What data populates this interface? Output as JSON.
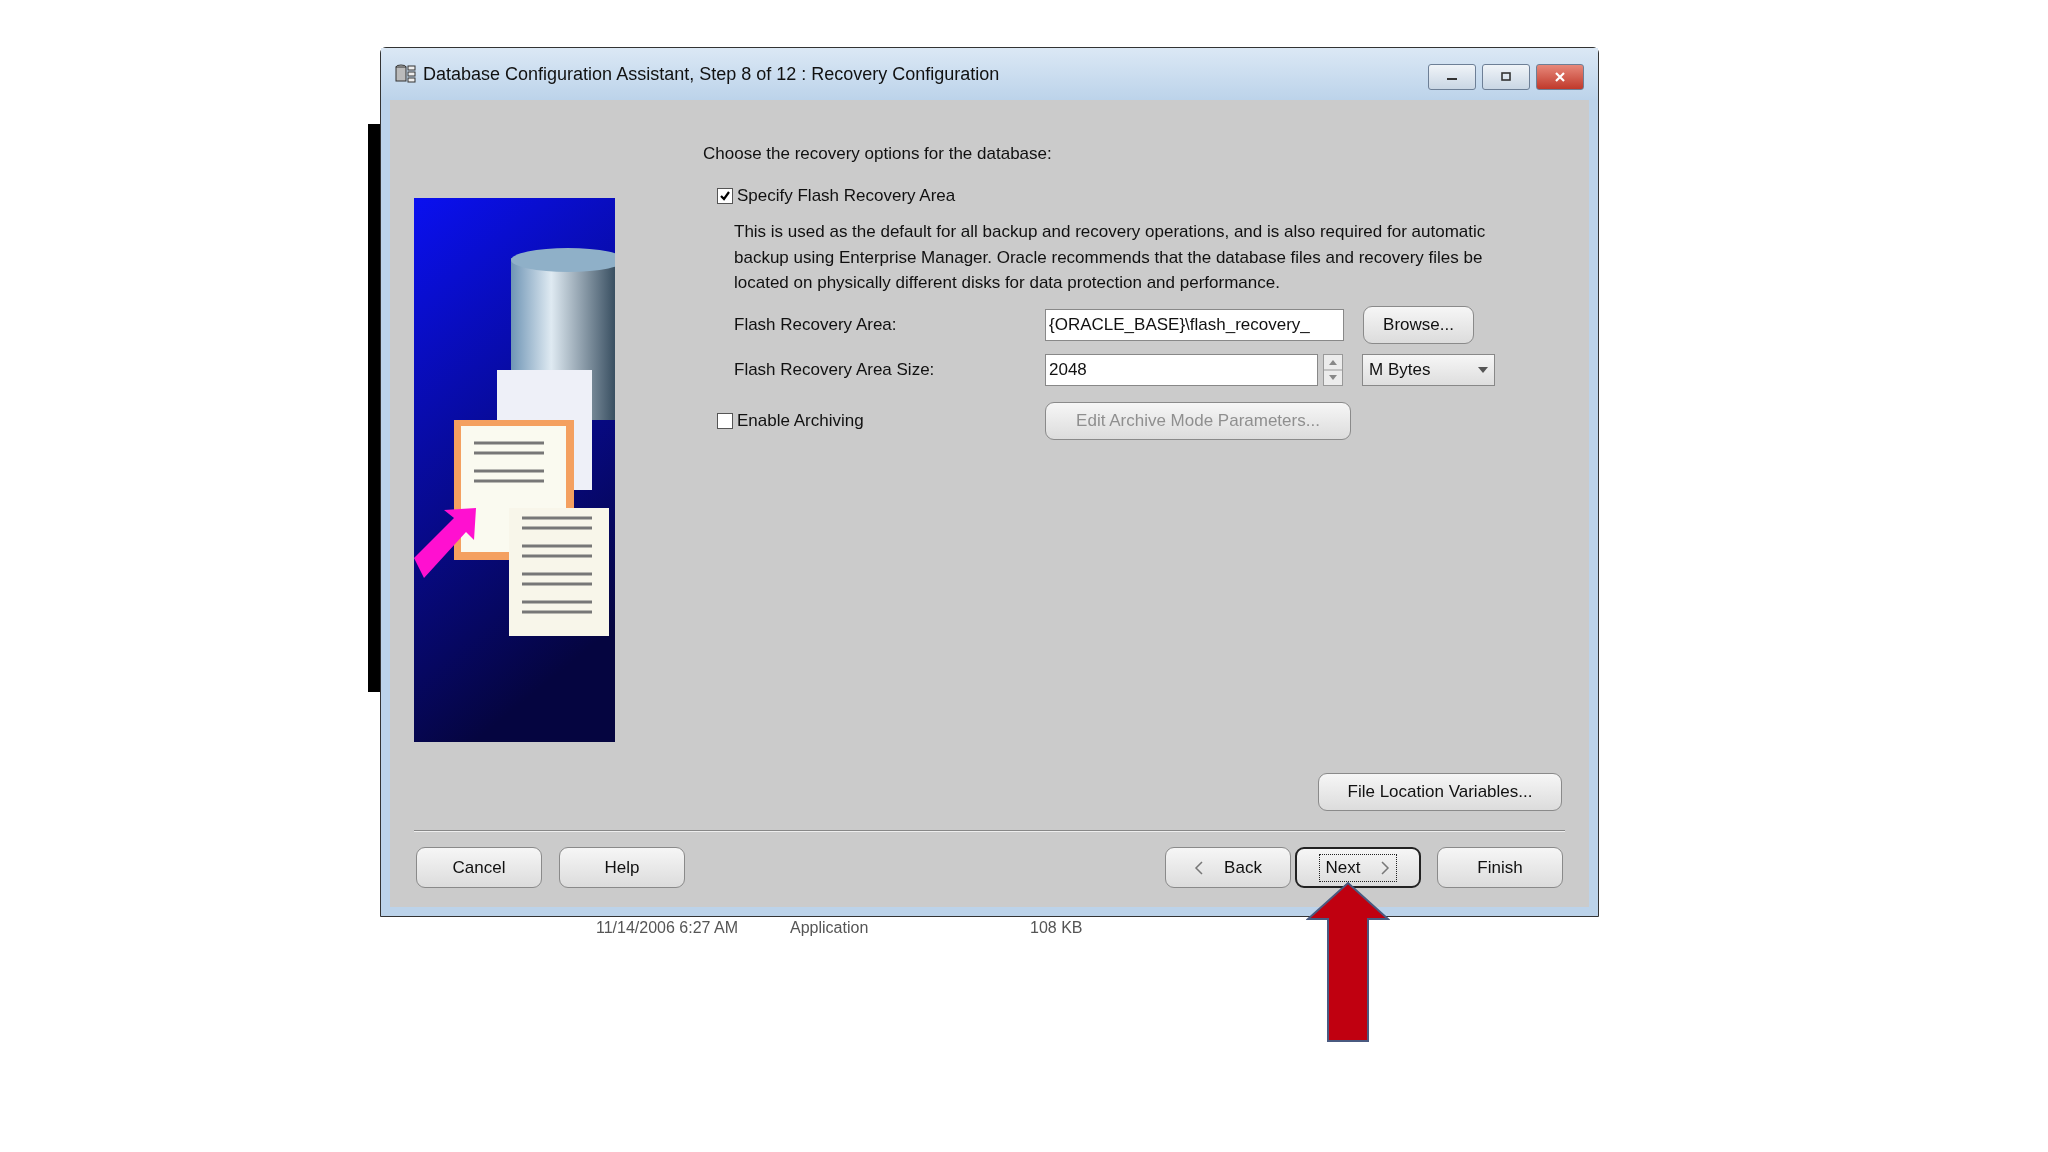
{
  "window": {
    "title": "Database Configuration Assistant, Step 8 of 12 : Recovery Configuration"
  },
  "prompt": "Choose the recovery options for the database:",
  "flash_recovery": {
    "label": "Specify Flash Recovery Area",
    "checked": true,
    "description": "This is used as the default for all backup and recovery operations, and is also required for automatic backup using Enterprise Manager. Oracle recommends that the database files and recovery files be located on physically different disks for data protection and performance.",
    "area": {
      "label": "Flash Recovery Area:",
      "value": "{ORACLE_BASE}\\flash_recovery_",
      "button": "Browse..."
    },
    "size": {
      "label": "Flash Recovery Area Size:",
      "value": "2048",
      "unit": "M Bytes"
    }
  },
  "archiving": {
    "label": "Enable Archiving",
    "checked": false,
    "button": {
      "label": "Edit Archive Mode Parameters...",
      "disabled": true
    }
  },
  "file_location_button": "File Location Variables...",
  "left_buttons": [
    {
      "label": "Cancel",
      "focused": false
    },
    {
      "label": "Help",
      "focused": false
    }
  ],
  "right_buttons": [
    {
      "label": "Back",
      "kind": "back",
      "focused": false
    },
    {
      "label": "Next",
      "kind": "next",
      "focused": true
    },
    {
      "label": "Finish",
      "kind": "plain",
      "focused": false
    }
  ],
  "background_listing": [
    "11/14/2006 6:27 AM",
    "Application",
    "108 KB"
  ]
}
